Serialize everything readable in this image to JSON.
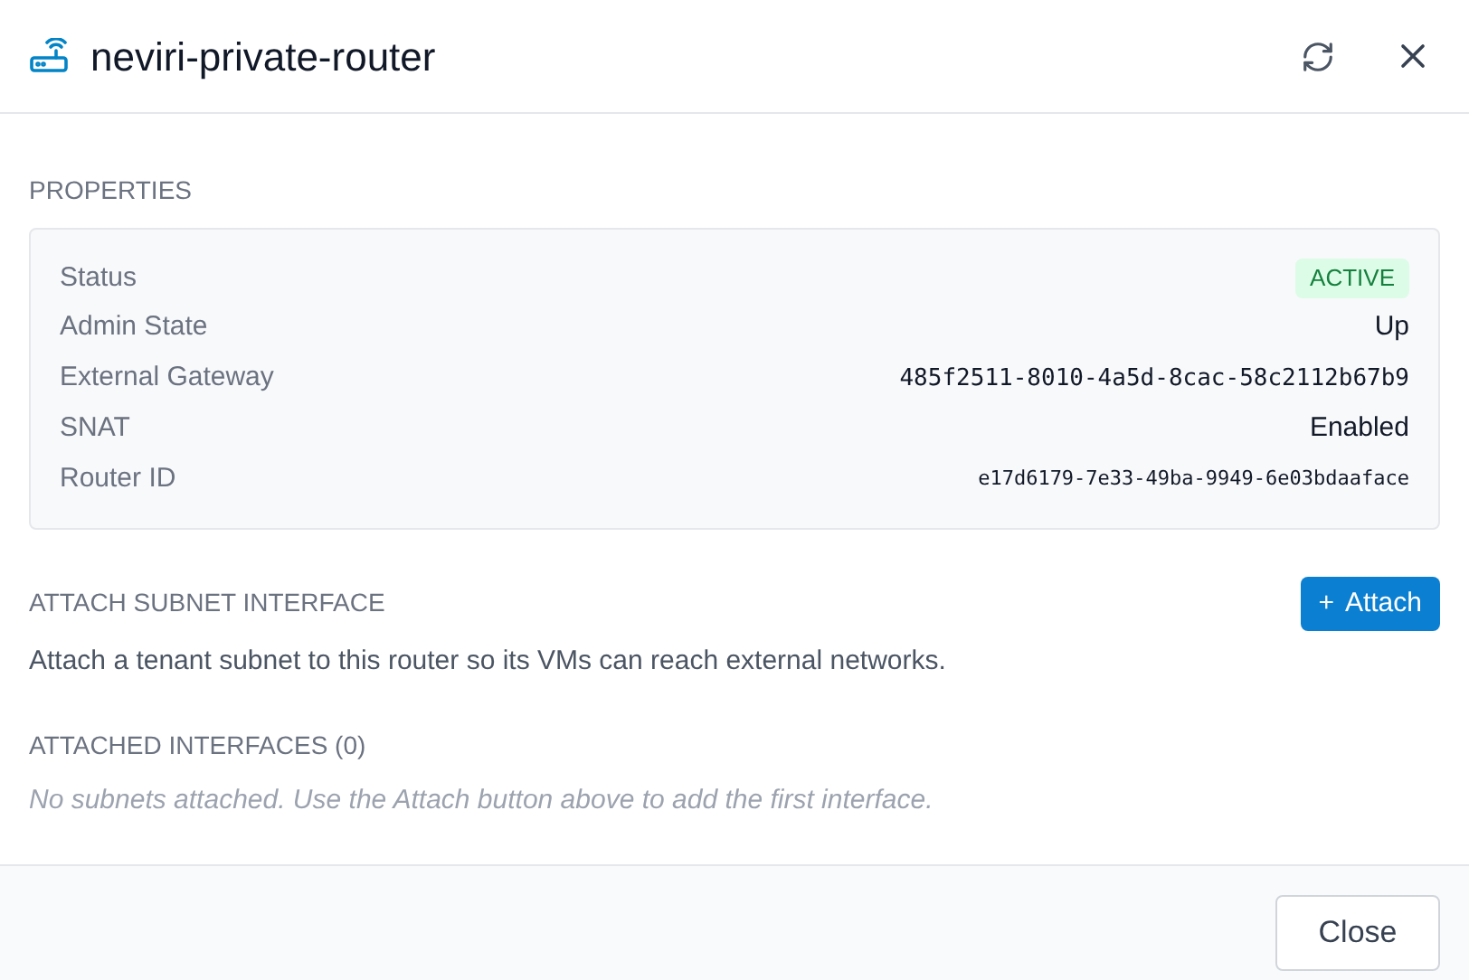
{
  "dialog": {
    "title": "neviri-private-router"
  },
  "properties": {
    "heading": "PROPERTIES",
    "rows": [
      {
        "label": "Status",
        "value": "ACTIVE",
        "kind": "badge"
      },
      {
        "label": "Admin State",
        "value": "Up",
        "kind": "text"
      },
      {
        "label": "External Gateway",
        "value": "485f2511-8010-4a5d-8cac-58c2112b67b9",
        "kind": "code"
      },
      {
        "label": "SNAT",
        "value": "Enabled",
        "kind": "text"
      },
      {
        "label": "Router ID",
        "value": "e17d6179-7e33-49ba-9949-6e03bdaaface",
        "kind": "code-small"
      }
    ]
  },
  "attach": {
    "heading": "ATTACH SUBNET INTERFACE",
    "button": {
      "icon": "+",
      "label": "Attach"
    },
    "description": "Attach a tenant subnet to this router so its VMs can reach external networks."
  },
  "interfaces": {
    "heading": "ATTACHED INTERFACES (0)",
    "empty": "No subnets attached. Use the Attach button above to add the first interface."
  },
  "footer": {
    "close": "Close"
  }
}
